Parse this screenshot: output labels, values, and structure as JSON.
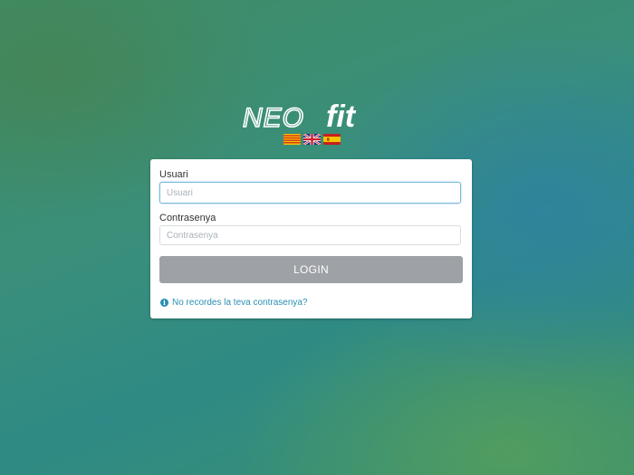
{
  "brand": {
    "part1": "NEO",
    "part2": "fit"
  },
  "languages": [
    {
      "code": "ca",
      "icon": "catalan-flag-icon"
    },
    {
      "code": "en",
      "icon": "uk-flag-icon"
    },
    {
      "code": "es",
      "icon": "spain-flag-icon"
    }
  ],
  "login": {
    "username_label": "Usuari",
    "username_placeholder": "Usuari",
    "username_value": "",
    "password_label": "Contrasenya",
    "password_placeholder": "Contrasenya",
    "password_value": "",
    "submit_label": "LOGIN",
    "forgot_label": "No recordes la teva contrasenya?"
  },
  "colors": {
    "button": "#9ea2a7",
    "link": "#2a8fb3",
    "focus_border": "#7ab8da"
  }
}
